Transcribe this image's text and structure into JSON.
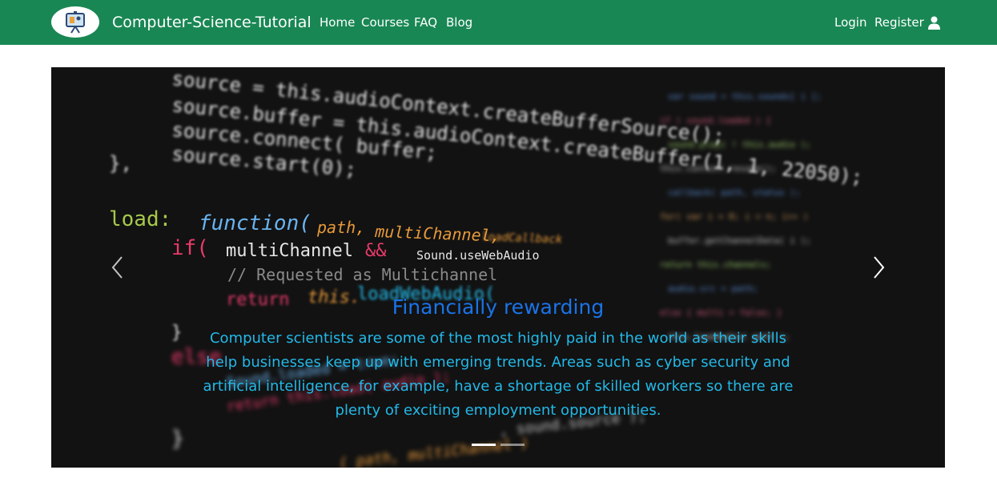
{
  "navbar": {
    "brand": "Computer-Science-Tutorial",
    "links": [
      "Home",
      "Courses",
      "FAQ",
      "Blog"
    ],
    "login": "Login",
    "register": "Register",
    "logo_icon": "classroom-logo",
    "user_icon": "user-icon",
    "background": "#198754"
  },
  "carousel": {
    "slide": {
      "title": "Financially rewarding",
      "text": "Computer scientists are some of the most highly paid in the world as their skills help businesses keep up with emerging trends. Areas such as cyber security and artificial intelligence, for example, have a shortage of skilled workers so there are plenty of exciting employment opportunities."
    },
    "background_code": {
      "line1": "source = this.audioContext.createBufferSource();",
      "line2": "source.buffer = this.audioContext.createBuffer(1, 1, 22050);",
      "line3": "source.connect( buffer;",
      "line4": "source.start(0);",
      "line5": "},",
      "load": "load:",
      "function": "function(",
      "path": "path,",
      "multiChannel": "multiChannel,",
      "loadCallback": "loadCallback",
      "if": "if(",
      "multiChannel2": "multiChannel",
      "amp": "&&",
      "webaudio": "Sound.useWebAudio",
      "comment": "// Requested as Multichannel",
      "return": "return",
      "this": "this.",
      "loadwebaudio": "loadWebAudio(",
      "close": "}",
      "else": "else"
    },
    "indicators": 2,
    "active_index": 0,
    "prev_icon": "chevron-left-icon",
    "next_icon": "chevron-right-icon"
  }
}
